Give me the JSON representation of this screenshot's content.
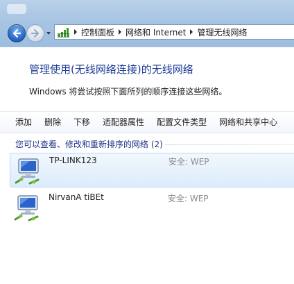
{
  "navigation": {
    "back_label": "",
    "forward_label": ""
  },
  "address_bar": {
    "crumbs": [
      "控制面板",
      "网络和 Internet",
      "管理无线网络"
    ]
  },
  "page": {
    "title": "管理使用(无线网络连接)的无线网络",
    "description": "Windows 将尝试按照下面所列的顺序连接这些网络。"
  },
  "toolbar": {
    "items": [
      "添加",
      "删除",
      "下移",
      "适配器属性",
      "配置文件类型",
      "网络和共享中心"
    ]
  },
  "networks_group": {
    "header": "您可以查看、修改和重新排序的网络 (2)",
    "items": [
      {
        "name": "TP-LINK123",
        "security": "安全: WEP",
        "selected": true,
        "icon": "wireless-network-icon"
      },
      {
        "name": "NirvanA tiBEt",
        "security": "安全: WEP",
        "selected": false,
        "icon": "wireless-network-icon"
      }
    ]
  },
  "colors": {
    "title_blue": "#1e3c96",
    "header_blue": "#1e3287",
    "security_gray": "#8a8a8a",
    "selection_border": "#b8d6fb"
  }
}
